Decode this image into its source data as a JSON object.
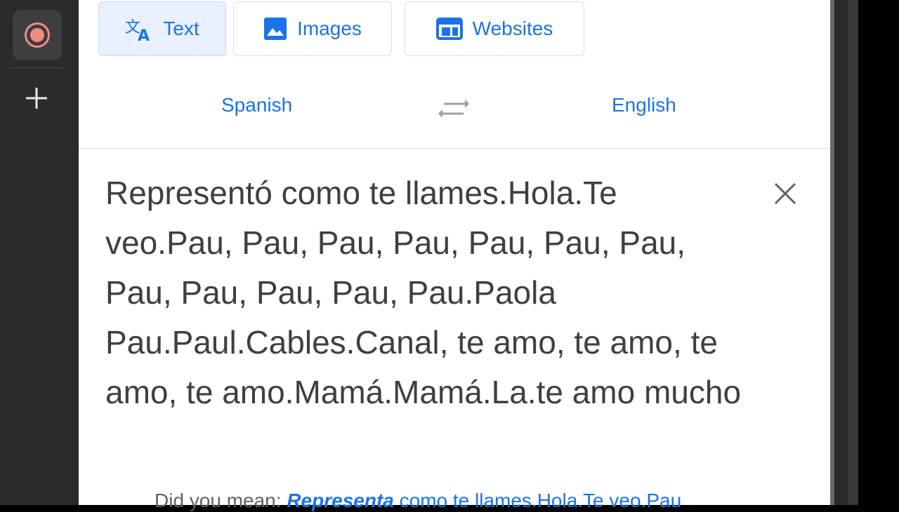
{
  "tabs": [
    {
      "label": "Text",
      "icon": "translate-icon",
      "active": true
    },
    {
      "label": "Images",
      "icon": "image-icon",
      "active": false
    },
    {
      "label": "Websites",
      "icon": "website-icon",
      "active": false
    }
  ],
  "languages": {
    "source": "Spanish",
    "target": "English",
    "swap_icon": "swap-arrows-icon"
  },
  "input": {
    "text": "Representó como te llames.Hola.Te veo.Pau, Pau, Pau, Pau, Pau, Pau, Pau, Pau, Pau, Pau, Pau, Pau.Paola Pau.Paul.Cables.Canal, te amo, te amo, te amo, te amo.Mamá.Mamá.La.te amo mucho"
  },
  "suggestion": {
    "prefix": "Did you mean:",
    "corrected_word": "Representa",
    "rest": "como te llames.Hola.Te veo.Pau"
  },
  "side_rail": {
    "record_icon": "record-icon",
    "add_icon": "plus-icon"
  },
  "colors": {
    "accent": "#1a73e8",
    "record": "#f28b82",
    "rail_bg": "#2b2b2b"
  }
}
